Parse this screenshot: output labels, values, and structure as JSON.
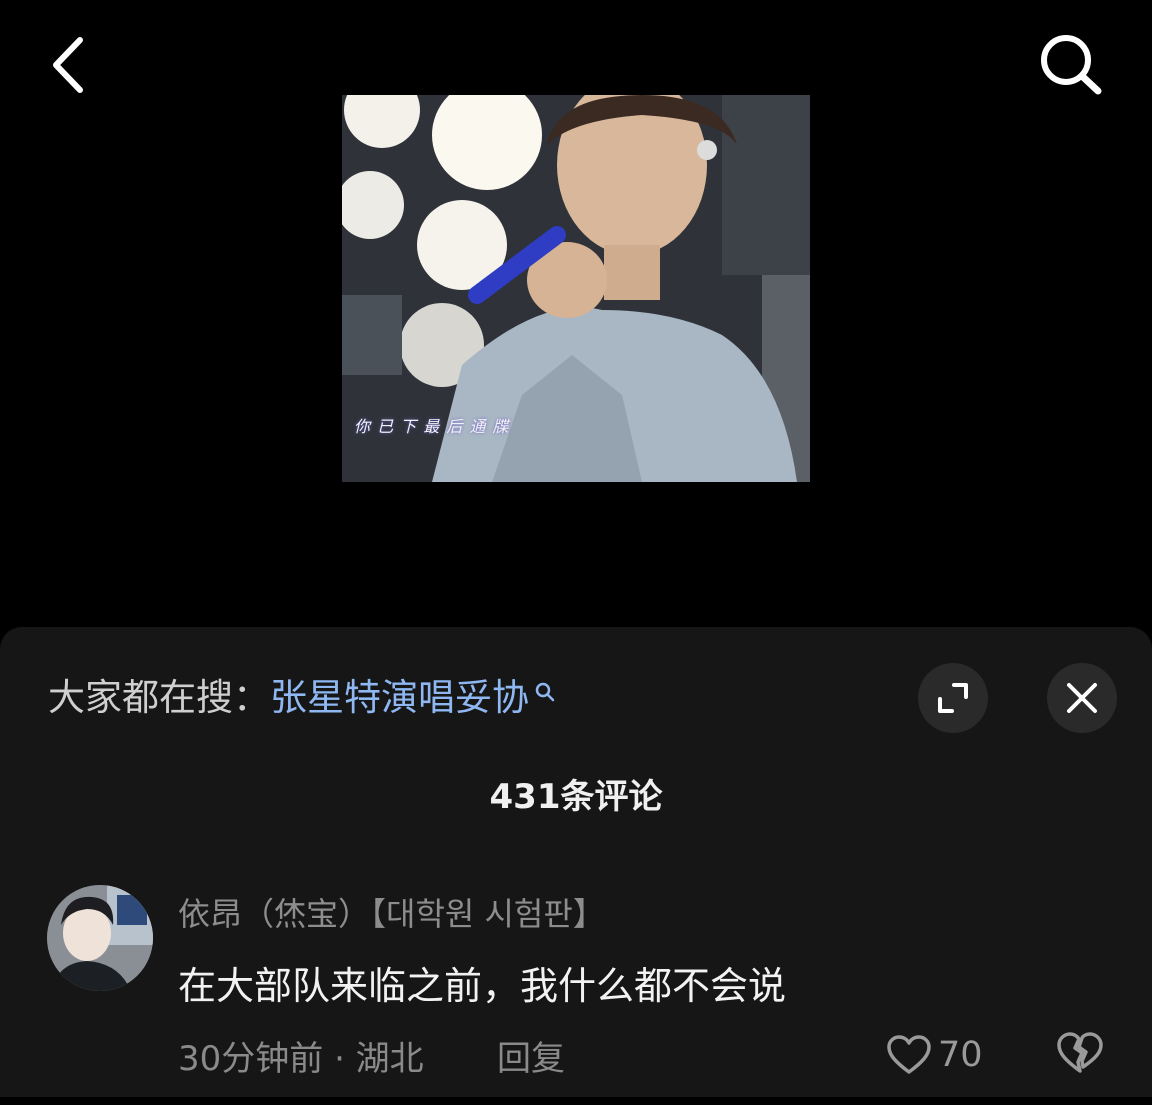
{
  "top_bar": {
    "back_icon": "chevron-left-icon",
    "search_icon": "search-icon"
  },
  "video": {
    "subtitle": "你 已 下 最 后 通 牒"
  },
  "sheet": {
    "search_hint_prefix": "大家都在搜：",
    "search_hint_keyword": "张星特演唱妥协",
    "expand_icon": "expand-icon",
    "close_icon": "close-icon",
    "comment_count": "431条评论"
  },
  "comment": {
    "username": "依昂（烋宝）【대학원 시험판】",
    "text": "在大部队来临之前，我什么都不会说",
    "meta": "30分钟前 · 湖北",
    "reply_label": "回复",
    "like_count": "70",
    "like_icon": "heart-icon",
    "dislike_icon": "broken-heart-icon"
  },
  "colors": {
    "background": "#000000",
    "sheet_bg": "#161616",
    "keyword": "#8fb8f2",
    "muted": "#8a8a8a"
  }
}
